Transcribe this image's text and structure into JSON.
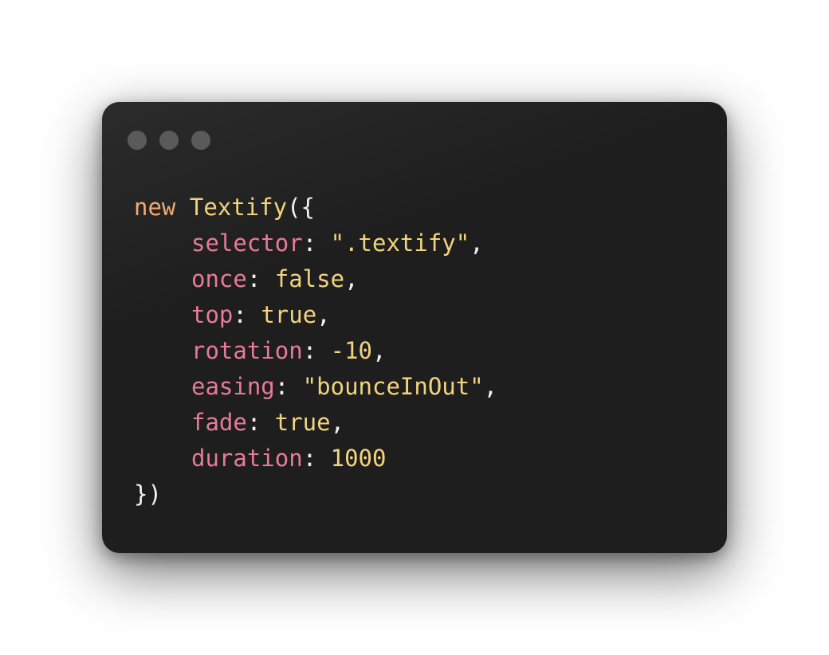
{
  "window": {
    "controls": [
      "close",
      "minimize",
      "maximize"
    ]
  },
  "code": {
    "line1": {
      "keyword": "new",
      "class_name": "Textify",
      "open": "({"
    },
    "props": [
      {
        "key": "selector",
        "value": "\".textify\"",
        "trail": ","
      },
      {
        "key": "once",
        "value": "false",
        "trail": ","
      },
      {
        "key": "top",
        "value": "true",
        "trail": ","
      },
      {
        "key": "rotation",
        "value": "-10",
        "trail": ","
      },
      {
        "key": "easing",
        "value": "\"bounceInOut\"",
        "trail": ","
      },
      {
        "key": "fade",
        "value": "true",
        "trail": ","
      },
      {
        "key": "duration",
        "value": "1000",
        "trail": ""
      }
    ],
    "close": "})"
  },
  "colors": {
    "keyword": "#f5a86e",
    "class": "#f2d47e",
    "property": "#e87a9b",
    "value": "#f2d47e",
    "punctuation": "#f2f2f2",
    "window_bg": "#1e1e1e",
    "dot": "#5a5a5a"
  }
}
